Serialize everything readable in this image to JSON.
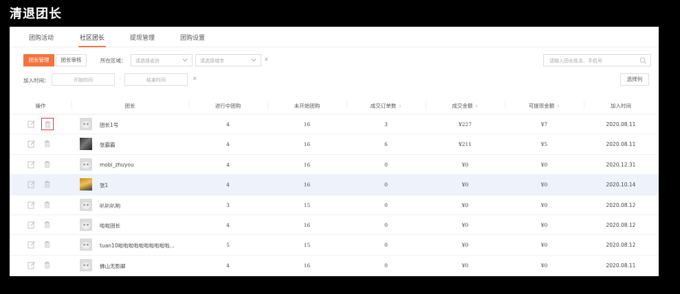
{
  "page_title": "清退团长",
  "tabs": [
    {
      "label": "团购活动"
    },
    {
      "label": "社区团长"
    },
    {
      "label": "提现管理"
    },
    {
      "label": "团购设置"
    }
  ],
  "filters": {
    "btn_manage": "团长管理",
    "btn_review": "团长审核",
    "region_label": "所在区域：",
    "province_placeholder": "请选择省份",
    "city_placeholder": "请选择城市",
    "clear": "×",
    "join_label": "加入时间：",
    "start_placeholder": "开始时间",
    "dash": "-",
    "end_placeholder": "结束时间",
    "search_placeholder": "请输入团长姓名、手机号",
    "select_cols": "选择列"
  },
  "table": {
    "headers": [
      "操作",
      "团长",
      "进行中团购",
      "未开始团购",
      "成交订单数",
      "成交金额",
      "可提现金额",
      "加入时间"
    ],
    "sort_glyph": "⇳",
    "rows": [
      {
        "name": "团长1号",
        "ongoing": "4",
        "upcoming": "16",
        "orders": "3",
        "amount": "¥227",
        "withdrawable": "¥7",
        "joined": "2020.08.11"
      },
      {
        "name": "张霸霸",
        "ongoing": "4",
        "upcoming": "16",
        "orders": "6",
        "amount": "¥211",
        "withdrawable": "¥5",
        "joined": "2020.08.11"
      },
      {
        "name": "mobi_zhuyou",
        "ongoing": "4",
        "upcoming": "16",
        "orders": "0",
        "amount": "¥0",
        "withdrawable": "¥0",
        "joined": "2020.12.31"
      },
      {
        "name": "张1",
        "ongoing": "4",
        "upcoming": "16",
        "orders": "0",
        "amount": "¥0",
        "withdrawable": "¥0",
        "joined": "2020.10.14"
      },
      {
        "name": "叭叭叭哟",
        "ongoing": "3",
        "upcoming": "15",
        "orders": "0",
        "amount": "¥0",
        "withdrawable": "¥0",
        "joined": "2020.08.12"
      },
      {
        "name": "啦啦团长",
        "ongoing": "4",
        "upcoming": "16",
        "orders": "0",
        "amount": "¥0",
        "withdrawable": "¥0",
        "joined": "2020.08.12"
      },
      {
        "name": "tuan10啦啦啦啦啦啦啦啦啦啦...",
        "ongoing": "5",
        "upcoming": "15",
        "orders": "0",
        "amount": "¥0",
        "withdrawable": "¥0",
        "joined": "2020.08.12"
      },
      {
        "name": "佛山无影脚",
        "ongoing": "4",
        "upcoming": "16",
        "orders": "0",
        "amount": "¥0",
        "withdrawable": "¥0",
        "joined": "2020.08.11"
      }
    ]
  },
  "colors": {
    "accent": "#f5733d",
    "highlight_row": "#eef2fb",
    "delete_box": "#e5322d"
  }
}
